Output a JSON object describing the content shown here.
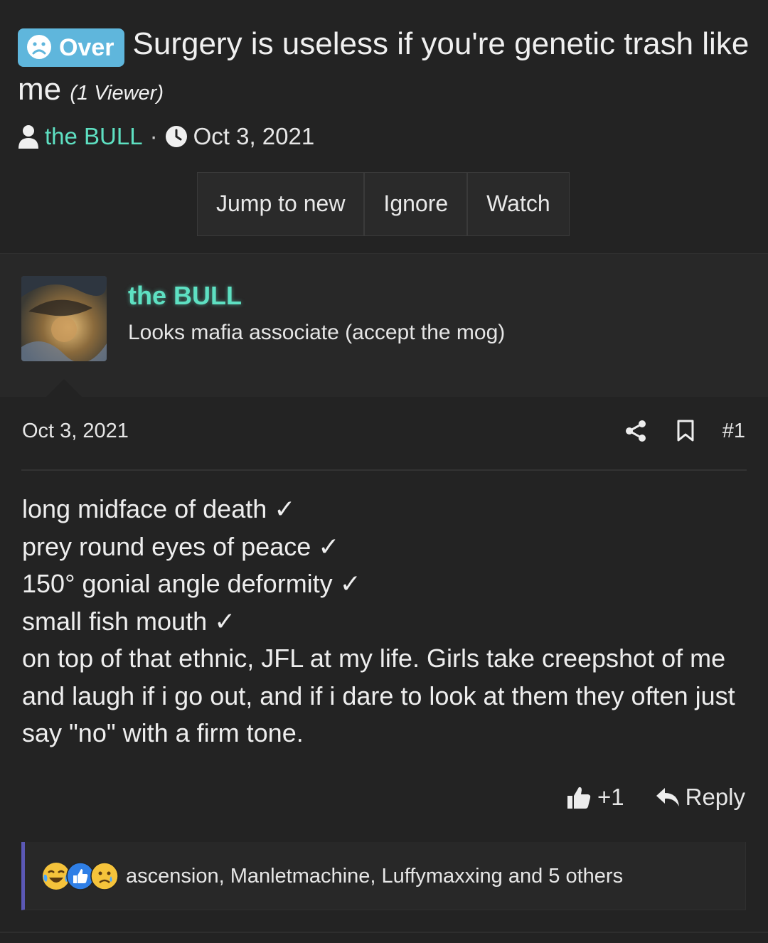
{
  "thread": {
    "prefix_label": "Over",
    "title": "Surgery is useless if you're genetic trash like me",
    "viewers": "(1 Viewer)",
    "author": "the BULL",
    "date": "Oct 3, 2021",
    "buttons": [
      "Jump to new",
      "Ignore",
      "Watch"
    ]
  },
  "author_card": {
    "name": "the BULL",
    "user_title": "Looks mafia associate (accept the mog)"
  },
  "post": {
    "date": "Oct 3, 2021",
    "number": "#1",
    "lines": [
      "long midface of death ✓",
      "prey round eyes of peace ✓",
      "150° gonial angle deformity ✓",
      "small fish mouth ✓",
      "on top of that ethnic, JFL at my life. Girls take creepshot of me and laugh if i go out, and if i dare to look at them they often just say \"no\" with a firm tone."
    ],
    "like_label": "+1",
    "reply_label": "Reply",
    "reactions_text": "ascension, Manletmachine, Luffymaxxing and 5 others"
  },
  "colors": {
    "background": "#232323",
    "accent_username": "#5ee0c2",
    "prefix_bg": "#5fb6dc",
    "reactions_border": "#5b58b5"
  },
  "icons": [
    "sad-face-icon",
    "user-icon",
    "clock-icon",
    "share-icon",
    "bookmark-icon",
    "thumbs-up-icon",
    "reply-icon",
    "laugh-cry-emoji-icon",
    "like-emoji-icon",
    "sad-emoji-icon"
  ]
}
